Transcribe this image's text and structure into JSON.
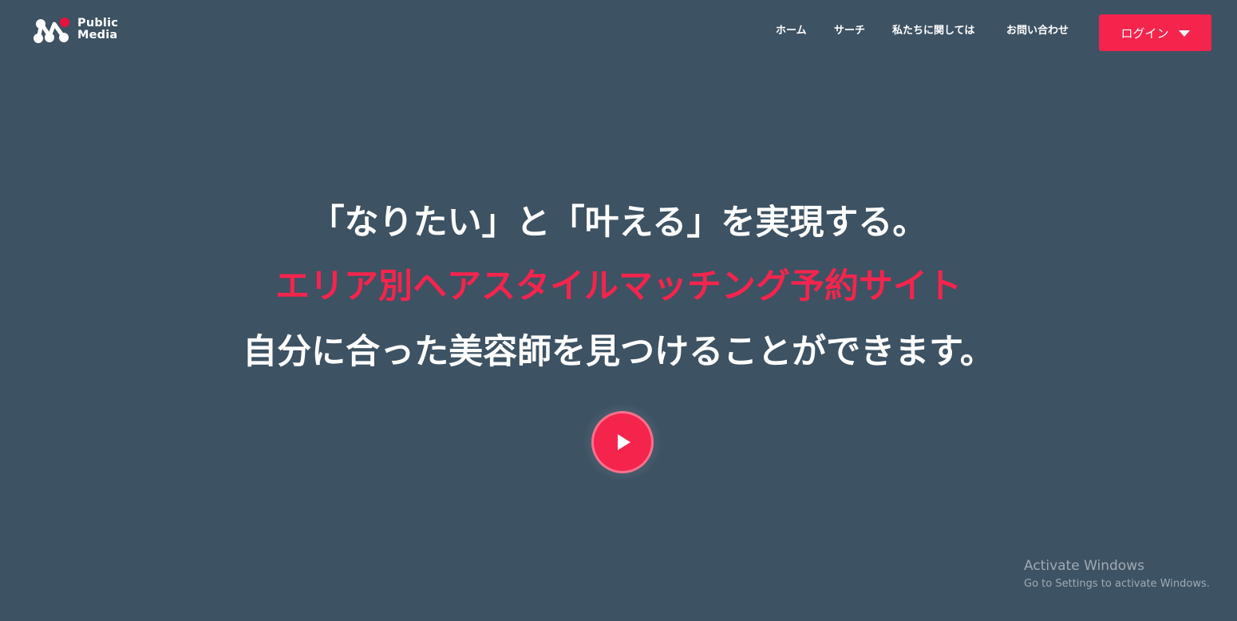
{
  "header": {
    "logo": {
      "line1": "Public",
      "line2": "Media"
    },
    "nav": [
      {
        "label": "ホーム"
      },
      {
        "label": "サーチ"
      },
      {
        "label": "私たちに関しては"
      },
      {
        "label": "お問い合わせ"
      }
    ],
    "login": {
      "label": "ログイン",
      "icon": "caret-down-icon"
    }
  },
  "hero": {
    "line1": "「なりたい」と「叶える」を実現する。",
    "line2": "エリア別ヘアスタイルマッチング予約サイト",
    "line3": "自分に合った美容師を見つけることができます。",
    "play_icon": "play-icon"
  },
  "watermark": {
    "title": "Activate Windows",
    "subtitle": "Go to Settings to activate Windows."
  },
  "colors": {
    "background": "#3d5263",
    "accent": "#f5244d",
    "text": "#ffffff"
  }
}
